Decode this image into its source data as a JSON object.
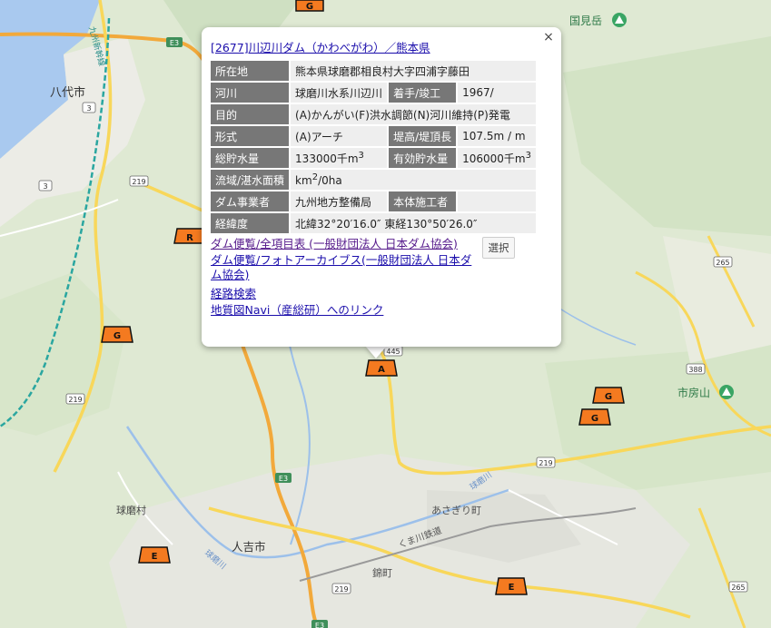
{
  "popup": {
    "title": "[2677]川辺川ダム（かわべがわ）／熊本県",
    "close": "×",
    "rows": [
      {
        "l1": "所在地",
        "v1": "熊本県球磨郡相良村大字四浦字藤田"
      },
      {
        "l1": "河川",
        "v1": "球磨川水系川辺川",
        "l2": "着手/竣工",
        "v2": "1967/"
      },
      {
        "l1": "目的",
        "v1": "(A)かんがい(F)洪水調節(N)河川維持(P)発電"
      },
      {
        "l1": "形式",
        "v1": "(A)アーチ",
        "l2": "堤高/堤頂長",
        "v2": "107.5m / m"
      },
      {
        "l1": "総貯水量",
        "v1": "133000千m",
        "v1sup": "3",
        "l2": "有効貯水量",
        "v2": "106000千m",
        "v2sup": "3"
      },
      {
        "l1": "流域/湛水面積",
        "v1": "km",
        "v1sup": "2",
        "v1tail": "/0ha"
      },
      {
        "l1": "ダム事業者",
        "v1": "九州地方整備局",
        "l2": "本体施工者",
        "v2": ""
      },
      {
        "l1": "経緯度",
        "v1": "北緯32°20′16.0″ 東経130°50′26.0″"
      }
    ],
    "links": [
      "ダム便覧/全項目表 (一般財団法人 日本ダム協会)",
      "ダム便覧/フォトアーカイブス(一般財団法人 日本ダム協会)",
      "経路検索",
      "地質図Navi（産総研）へのリンク"
    ],
    "select_label": "選択"
  },
  "map": {
    "places": {
      "yatsushiro": "八代市",
      "kunimi": "国見岳",
      "ichifusa": "市房山",
      "kuma_village": "球磨村",
      "hitoyoshi": "人吉市",
      "asagiri": "あさぎり町",
      "nishiki": "錦町",
      "kumagawa_railway": "くま川鉄道",
      "kyushu_shinkansen": "九州新幹線",
      "kuma_river": "球磨川",
      "kuma_river2": "球磨川"
    },
    "roads": {
      "e3_a": "E3",
      "e3_b": "E3",
      "e3_c": "E3",
      "r3_a": "3",
      "r3_b": "3",
      "r219_a": "219",
      "r219_b": "219",
      "r219_c": "219",
      "r219_d": "219",
      "r445": "445",
      "r265_a": "265",
      "r265_b": "265",
      "r388": "388"
    },
    "markers": [
      {
        "letter": "G"
      },
      {
        "letter": "R"
      },
      {
        "letter": "G"
      },
      {
        "letter": "A"
      },
      {
        "letter": "G"
      },
      {
        "letter": "G"
      },
      {
        "letter": "E"
      },
      {
        "letter": "E"
      }
    ]
  }
}
